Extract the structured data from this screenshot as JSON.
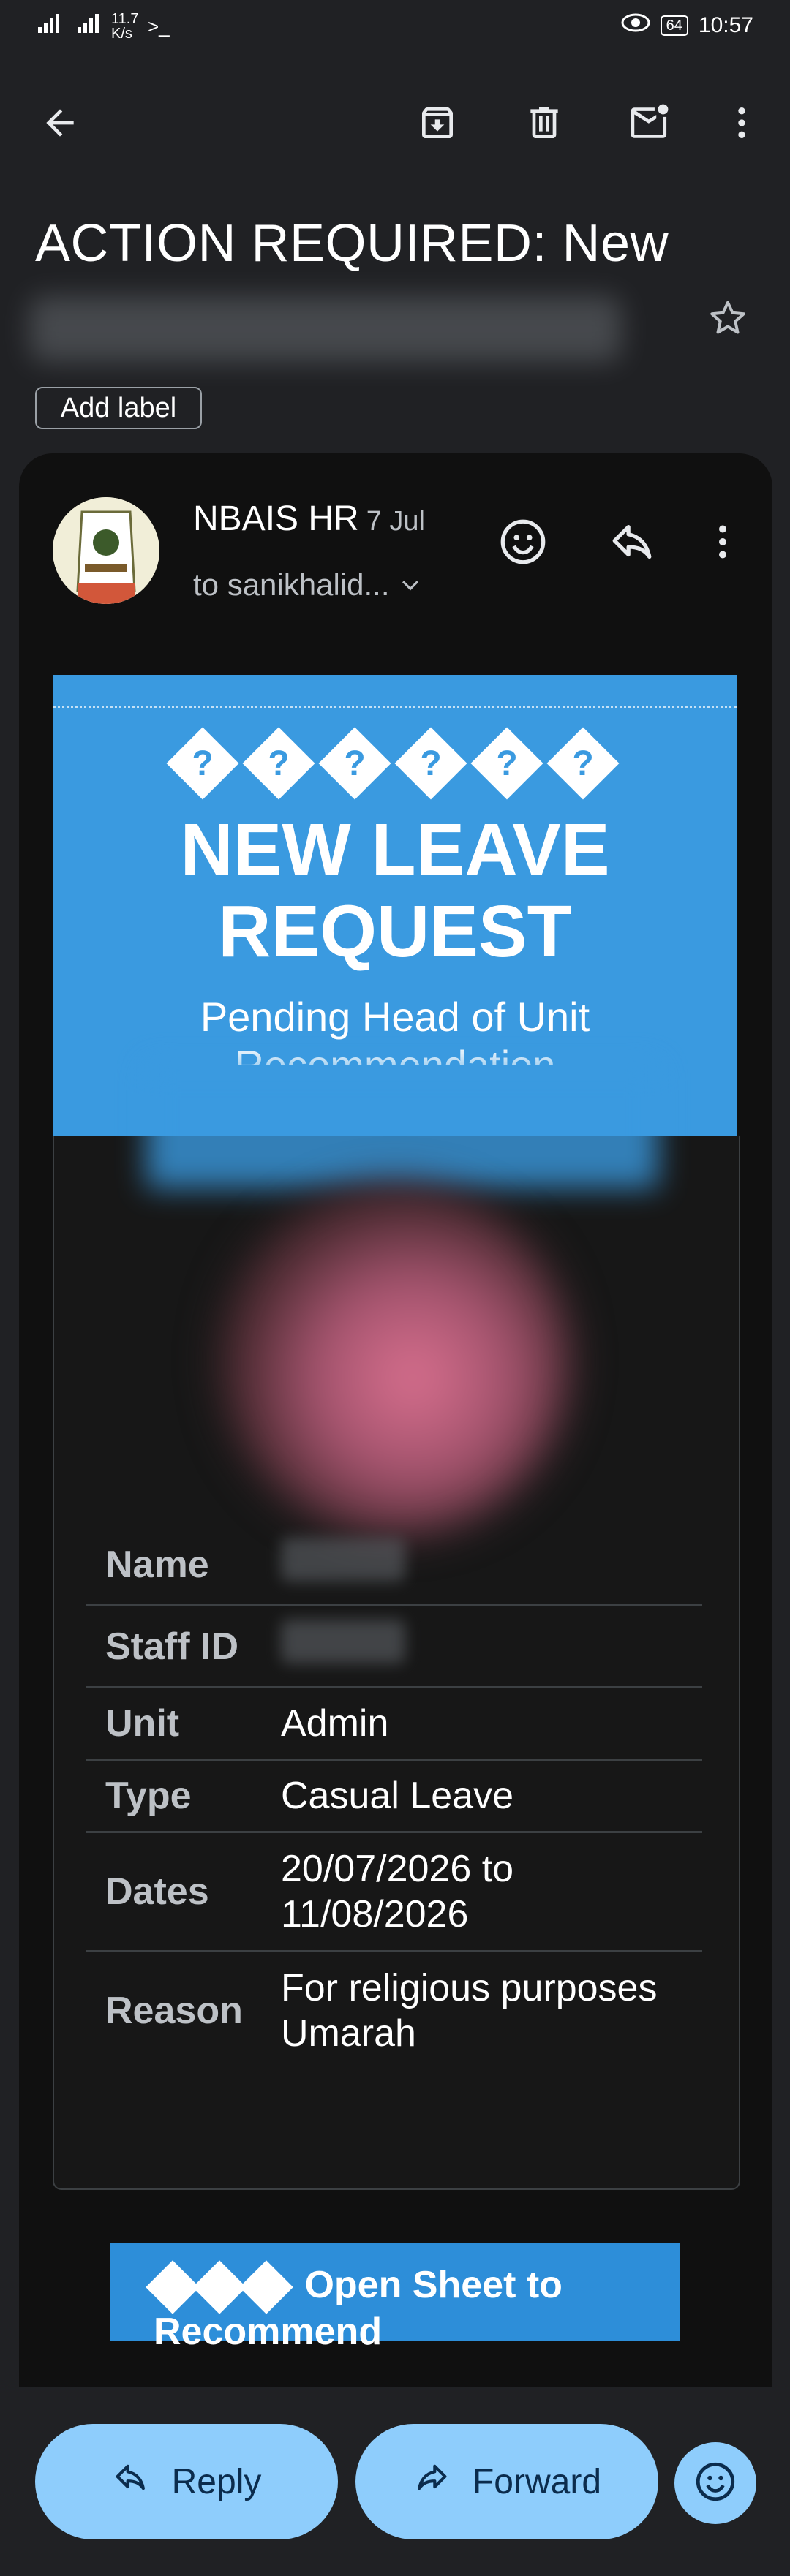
{
  "status_bar": {
    "network_1": "4G",
    "speed": "11.7 K/s",
    "battery": "64",
    "time": "10:57"
  },
  "toolbar": {
    "back_icon": "arrow-back-icon",
    "archive_icon": "archive-icon",
    "delete_icon": "trash-icon",
    "mark_unread_icon": "mark-unread-icon",
    "more_icon": "more-vert-icon"
  },
  "email": {
    "subject": "ACTION REQUIRED: New",
    "add_label": "Add label",
    "sender": "NBAIS HR",
    "date": "7 Jul",
    "to": "to sanikhalid...",
    "banner": {
      "icons": [
        "?",
        "?",
        "?",
        "?",
        "?",
        "?"
      ],
      "headline_1": "NEW LEAVE",
      "headline_2": "REQUEST",
      "subtitle": "Pending Head of Unit Recommendation"
    },
    "details": [
      {
        "key": "Name",
        "value": ""
      },
      {
        "key": "Staff ID",
        "value": ""
      },
      {
        "key": "Unit",
        "value": "Admin"
      },
      {
        "key": "Type",
        "value": "Casual Leave"
      },
      {
        "key": "Dates",
        "value": "20/07/2026 to 11/08/2026"
      },
      {
        "key": "Reason",
        "value": "For religious purposes Umarah"
      }
    ],
    "cta_label": "Open Sheet to Recommend"
  },
  "actions": {
    "reply": "Reply",
    "forward": "Forward"
  },
  "colors": {
    "banner": "#3a9ae0",
    "pill": "#8ecdfc",
    "background": "#202124"
  }
}
